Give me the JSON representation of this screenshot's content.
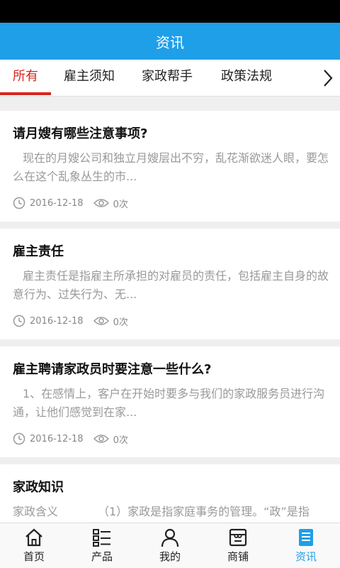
{
  "header": {
    "title": "资讯"
  },
  "tabs": [
    {
      "label": "所有",
      "active": true
    },
    {
      "label": "雇主须知",
      "active": false
    },
    {
      "label": "家政帮手",
      "active": false
    },
    {
      "label": "政策法规",
      "active": false
    }
  ],
  "articles": [
    {
      "title": "请月嫂有哪些注意事项?",
      "summary": "现在的月嫂公司和独立月嫂层出不穷，乱花渐欲迷人眼，要怎么在这个乱象丛生的市...",
      "date": "2016-12-18",
      "views": "0次"
    },
    {
      "title": "雇主责任",
      "summary": "雇主责任是指雇主所承担的对雇员的责任，包括雇主自身的故意行为、过失行为、无...",
      "date": "2016-12-18",
      "views": "0次"
    },
    {
      "title": "雇主聘请家政员时要注意一些什么?",
      "summary": "1、在感情上，客户在开始时要多与我们的家政服务员进行沟通，让他们感觉到在家...",
      "date": "2016-12-18",
      "views": "0次"
    },
    {
      "title": "家政知识",
      "summary": "家政含义　　　　（1）家政是指家庭事务的管理。“政”是指",
      "date": "",
      "views": ""
    }
  ],
  "bottom_nav": [
    {
      "label": "首页",
      "icon": "home-icon",
      "active": false
    },
    {
      "label": "产品",
      "icon": "product-list-icon",
      "active": false
    },
    {
      "label": "我的",
      "icon": "user-icon",
      "active": false
    },
    {
      "label": "商铺",
      "icon": "shop-icon",
      "active": false
    },
    {
      "label": "资讯",
      "icon": "news-icon",
      "active": true
    }
  ],
  "colors": {
    "primary": "#1e9fe8",
    "active_tab": "#d7261e"
  }
}
